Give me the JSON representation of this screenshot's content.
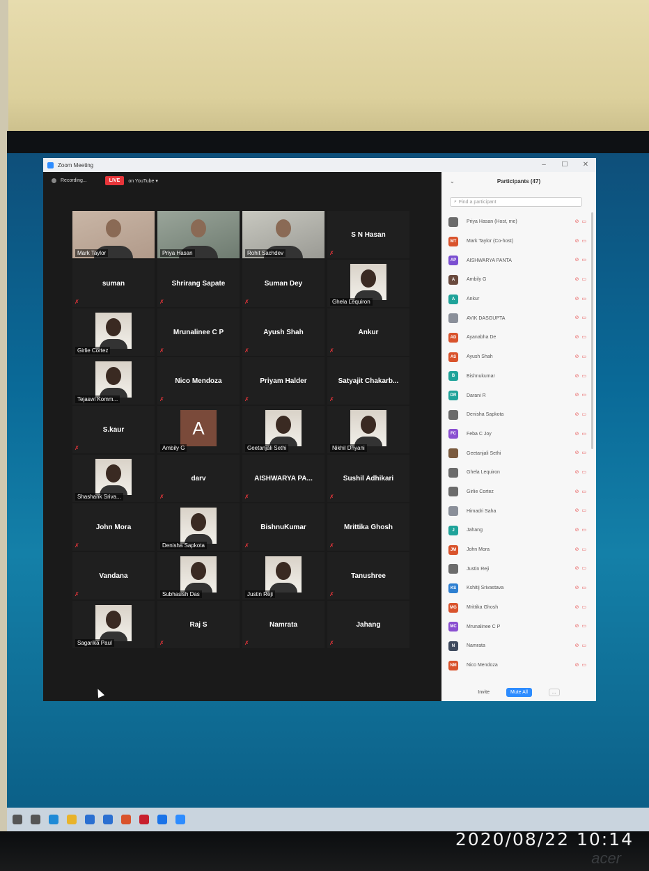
{
  "photo": {
    "timestamp": "2020/08/22  10:14",
    "monitor_brand": "acer"
  },
  "window": {
    "title": "Zoom Meeting"
  },
  "recording": {
    "status": "Recording...",
    "live_badge": "LIVE",
    "live_target": "on YouTube ▾"
  },
  "tiles": [
    {
      "name": "Mark Taylor",
      "kind": "video",
      "active": true
    },
    {
      "name": "Priya Hasan",
      "kind": "video"
    },
    {
      "name": "Rohit Sachdev",
      "kind": "video"
    },
    {
      "name": "S N Hasan",
      "kind": "name"
    },
    {
      "name": "suman",
      "kind": "name"
    },
    {
      "name": "Shrirang Sapate",
      "kind": "name"
    },
    {
      "name": "Suman Dey",
      "kind": "name"
    },
    {
      "name": "Ghela Lequiron",
      "kind": "photo"
    },
    {
      "name": "Girlie Cortez",
      "kind": "photo"
    },
    {
      "name": "Mrunalinee C P",
      "kind": "name"
    },
    {
      "name": "Ayush Shah",
      "kind": "name"
    },
    {
      "name": "Ankur",
      "kind": "name"
    },
    {
      "name": "Tejaswi Komm...",
      "kind": "photo"
    },
    {
      "name": "Nico Mendoza",
      "kind": "name"
    },
    {
      "name": "Priyam Halder",
      "kind": "name"
    },
    {
      "name": "Satyajit  Chakarb...",
      "kind": "name"
    },
    {
      "name": "S.kaur",
      "kind": "name"
    },
    {
      "name": "Ambily G",
      "kind": "avatar",
      "letter": "A"
    },
    {
      "name": "Geetanjali Sethi",
      "kind": "photo"
    },
    {
      "name": "Nikhil Dhyani",
      "kind": "photo"
    },
    {
      "name": "Shashank Sriva...",
      "kind": "photo"
    },
    {
      "name": "darv",
      "kind": "name"
    },
    {
      "name": "AISHWARYA  PA...",
      "kind": "name"
    },
    {
      "name": "Sushil Adhikari",
      "kind": "name"
    },
    {
      "name": "John Mora",
      "kind": "name"
    },
    {
      "name": "Denisha Sapkota",
      "kind": "photo"
    },
    {
      "name": "BishnuKumar",
      "kind": "name"
    },
    {
      "name": "Mrittika Ghosh",
      "kind": "name"
    },
    {
      "name": "Vandana",
      "kind": "name"
    },
    {
      "name": "Subhasish Das",
      "kind": "photo"
    },
    {
      "name": "Justin Reji",
      "kind": "photo"
    },
    {
      "name": "Tanushree",
      "kind": "name"
    },
    {
      "name": "Sagarika Paul",
      "kind": "photo"
    },
    {
      "name": "Raj S",
      "kind": "name"
    },
    {
      "name": "Namrata",
      "kind": "name"
    },
    {
      "name": "Jahang",
      "kind": "name"
    }
  ],
  "participants": {
    "title": "Participants (47)",
    "search_placeholder": "Find a participant",
    "list": [
      {
        "name": "Priya Hasan (Host, me)",
        "initials": "",
        "color": "#6b6b6b"
      },
      {
        "name": "Mark Taylor (Co-host)",
        "initials": "MT",
        "color": "#d9532c"
      },
      {
        "name": "AISHWARYA PANTA",
        "initials": "AP",
        "color": "#7b4fd1"
      },
      {
        "name": "Ambily G",
        "initials": "A",
        "color": "#6a4a3e"
      },
      {
        "name": "Ankur",
        "initials": "A",
        "color": "#1fa39a"
      },
      {
        "name": "AVIK DASGUPTA",
        "initials": "",
        "color": "#8a8f99"
      },
      {
        "name": "Ayanabha De",
        "initials": "AD",
        "color": "#d9532c"
      },
      {
        "name": "Ayush Shah",
        "initials": "AS",
        "color": "#d9532c"
      },
      {
        "name": "Bishnukumar",
        "initials": "B",
        "color": "#1fa39a"
      },
      {
        "name": "Darani R",
        "initials": "DR",
        "color": "#1fa39a"
      },
      {
        "name": "Denisha Sapkota",
        "initials": "",
        "color": "#6b6b6b"
      },
      {
        "name": "Feba C Joy",
        "initials": "FC",
        "color": "#8a4fd1"
      },
      {
        "name": "Geetanjali Sethi",
        "initials": "",
        "color": "#7a5a3e"
      },
      {
        "name": "Ghela Lequiron",
        "initials": "",
        "color": "#6b6b6b"
      },
      {
        "name": "Girlie Cortez",
        "initials": "",
        "color": "#6b6b6b"
      },
      {
        "name": "Himadri Saha",
        "initials": "",
        "color": "#8a8f99"
      },
      {
        "name": "Jahang",
        "initials": "J",
        "color": "#1fa39a"
      },
      {
        "name": "John Mora",
        "initials": "JM",
        "color": "#d9532c"
      },
      {
        "name": "Justin Reji",
        "initials": "",
        "color": "#6b6b6b"
      },
      {
        "name": "Kshitij Srivastava",
        "initials": "KS",
        "color": "#2d7fd1"
      },
      {
        "name": "Mrittika Ghosh",
        "initials": "MG",
        "color": "#d9532c"
      },
      {
        "name": "Mrunalinee C P",
        "initials": "MC",
        "color": "#8a4fd1"
      },
      {
        "name": "Namrata",
        "initials": "N",
        "color": "#3e4a5e"
      },
      {
        "name": "Nico Mendoza",
        "initials": "NM",
        "color": "#d9532c"
      }
    ],
    "footer": {
      "invite": "Invite",
      "mute_all": "Mute All",
      "more": "..."
    }
  },
  "taskbar": [
    "search",
    "task-view",
    "edge",
    "explorer",
    "mail",
    "files",
    "office",
    "mcafee",
    "chrome",
    "zoom"
  ]
}
